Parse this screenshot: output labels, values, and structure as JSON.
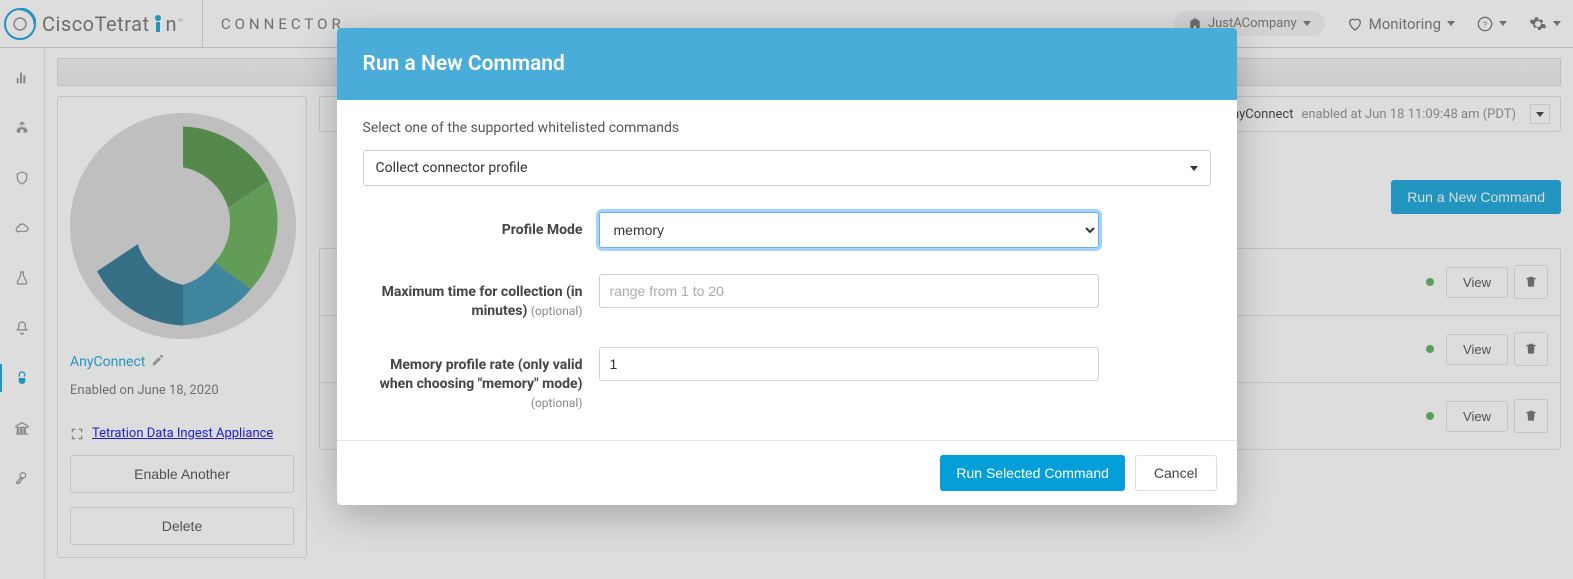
{
  "header": {
    "product_prefix": "CiscoTetrat",
    "product_highlight": "i",
    "product_suffix": "n",
    "breadcrumb": "CONNECTOR",
    "org": "JustACompany",
    "monitoring_label": "Monitoring"
  },
  "sidebar": {
    "items": [
      {
        "name": "analytics-icon"
      },
      {
        "name": "sitemap-icon"
      },
      {
        "name": "shield-icon"
      },
      {
        "name": "cloud-icon"
      },
      {
        "name": "flask-icon"
      },
      {
        "name": "bell-icon"
      },
      {
        "name": "connector-icon",
        "active": true
      },
      {
        "name": "security-icon"
      },
      {
        "name": "key-icon"
      }
    ]
  },
  "connector_card": {
    "name": "AnyConnect",
    "enabled_on": "Enabled on June 18, 2020",
    "appliance_link": "Tetration Data Ingest Appliance",
    "enable_another_label": "Enable Another",
    "delete_label": "Delete"
  },
  "status": {
    "name": "AnyConnect",
    "suffix": "enabled at Jun 18 11:09:48 am (PDT)"
  },
  "actions": {
    "run_new_cmd": "Run a New Command",
    "view_label": "View"
  },
  "rows": [
    {
      "view": "View"
    },
    {
      "view": "View"
    },
    {
      "view": "View"
    }
  ],
  "modal": {
    "title": "Run a New Command",
    "instruction": "Select one of the supported whitelisted commands",
    "command_selected": "Collect connector profile",
    "fields": {
      "profile_mode_label": "Profile Mode",
      "profile_mode_value": "memory",
      "max_time_label": "Maximum time for collection (in minutes)",
      "max_time_placeholder": "range from 1 to 20",
      "mem_rate_label": "Memory profile rate (only valid when choosing \"memory\" mode)",
      "mem_rate_value": "1",
      "optional_label": "(optional)"
    },
    "run_label": "Run Selected Command",
    "cancel_label": "Cancel"
  }
}
